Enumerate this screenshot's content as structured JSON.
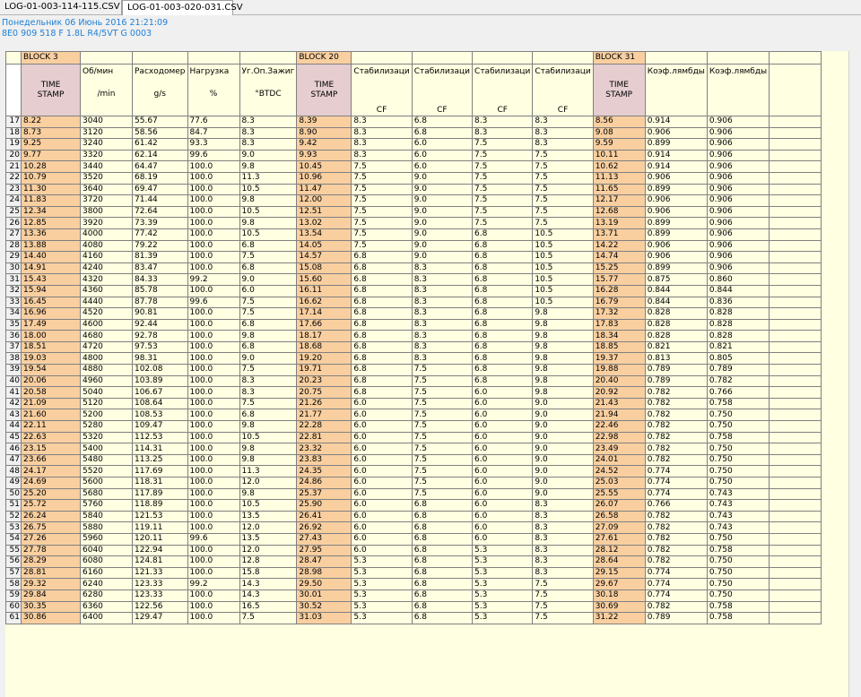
{
  "tabs": [
    "LOG-01-003-114-115.CSV",
    "LOG-01-003-020-031.CSV"
  ],
  "info": {
    "line1": "Понедельник 06 Июнь 2016 21:21:09",
    "line2": "8E0 909 518 F  1.8L R4/5VT     G   0003"
  },
  "blocks": {
    "b3": "BLOCK 3",
    "b20": "BLOCK 20",
    "b31": "BLOCK 31"
  },
  "headers": [
    {
      "top": "",
      "unit": ""
    },
    {
      "top": "TIME\nSTAMP",
      "unit": "",
      "stamp": true
    },
    {
      "top": "Об/мин",
      "unit": "/min"
    },
    {
      "top": "Расходомер",
      "unit": "g/s"
    },
    {
      "top": "Нагрузка",
      "unit": "%"
    },
    {
      "top": "Уг.Оп.Зажиг",
      "unit": "°BTDC"
    },
    {
      "top": "TIME\nSTAMP",
      "unit": "",
      "stamp": true
    },
    {
      "top": "Стабилизаци",
      "unit": "CF",
      "cf": true
    },
    {
      "top": "Стабилизаци",
      "unit": "CF",
      "cf": true
    },
    {
      "top": "Стабилизаци",
      "unit": "CF",
      "cf": true
    },
    {
      "top": "Стабилизаци",
      "unit": "CF",
      "cf": true
    },
    {
      "top": "TIME\nSTAMP",
      "unit": "",
      "stamp": true
    },
    {
      "top": "Коэф.лямбды",
      "unit": ""
    },
    {
      "top": "Коэф.лямбды",
      "unit": ""
    },
    {
      "top": "",
      "unit": ""
    }
  ],
  "rows": [
    [
      "17",
      "8.22",
      "3040",
      "55.67",
      "77.6",
      "8.3",
      "8.39",
      "8.3",
      "6.8",
      "8.3",
      "8.3",
      "8.56",
      "0.914",
      "0.906"
    ],
    [
      "18",
      "8.73",
      "3120",
      "58.56",
      "84.7",
      "8.3",
      "8.90",
      "8.3",
      "6.8",
      "8.3",
      "8.3",
      "9.08",
      "0.906",
      "0.906"
    ],
    [
      "19",
      "9.25",
      "3240",
      "61.42",
      "93.3",
      "8.3",
      "9.42",
      "8.3",
      "6.0",
      "7.5",
      "8.3",
      "9.59",
      "0.899",
      "0.906"
    ],
    [
      "20",
      "9.77",
      "3320",
      "62.14",
      "99.6",
      "9.0",
      "9.93",
      "8.3",
      "6.0",
      "7.5",
      "7.5",
      "10.11",
      "0.914",
      "0.906"
    ],
    [
      "21",
      "10.28",
      "3440",
      "64.47",
      "100.0",
      "9.8",
      "10.45",
      "7.5",
      "6.0",
      "7.5",
      "7.5",
      "10.62",
      "0.914",
      "0.906"
    ],
    [
      "22",
      "10.79",
      "3520",
      "68.19",
      "100.0",
      "11.3",
      "10.96",
      "7.5",
      "9.0",
      "7.5",
      "7.5",
      "11.13",
      "0.906",
      "0.906"
    ],
    [
      "23",
      "11.30",
      "3640",
      "69.47",
      "100.0",
      "10.5",
      "11.47",
      "7.5",
      "9.0",
      "7.5",
      "7.5",
      "11.65",
      "0.899",
      "0.906"
    ],
    [
      "24",
      "11.83",
      "3720",
      "71.44",
      "100.0",
      "9.8",
      "12.00",
      "7.5",
      "9.0",
      "7.5",
      "7.5",
      "12.17",
      "0.906",
      "0.906"
    ],
    [
      "25",
      "12.34",
      "3800",
      "72.64",
      "100.0",
      "10.5",
      "12.51",
      "7.5",
      "9.0",
      "7.5",
      "7.5",
      "12.68",
      "0.906",
      "0.906"
    ],
    [
      "26",
      "12.85",
      "3920",
      "73.39",
      "100.0",
      "9.8",
      "13.02",
      "7.5",
      "9.0",
      "7.5",
      "7.5",
      "13.19",
      "0.899",
      "0.906"
    ],
    [
      "27",
      "13.36",
      "4000",
      "77.42",
      "100.0",
      "10.5",
      "13.54",
      "7.5",
      "9.0",
      "6.8",
      "10.5",
      "13.71",
      "0.899",
      "0.906"
    ],
    [
      "28",
      "13.88",
      "4080",
      "79.22",
      "100.0",
      "6.8",
      "14.05",
      "7.5",
      "9.0",
      "6.8",
      "10.5",
      "14.22",
      "0.906",
      "0.906"
    ],
    [
      "29",
      "14.40",
      "4160",
      "81.39",
      "100.0",
      "7.5",
      "14.57",
      "6.8",
      "9.0",
      "6.8",
      "10.5",
      "14.74",
      "0.906",
      "0.906"
    ],
    [
      "30",
      "14.91",
      "4240",
      "83.47",
      "100.0",
      "6.8",
      "15.08",
      "6.8",
      "8.3",
      "6.8",
      "10.5",
      "15.25",
      "0.899",
      "0.906"
    ],
    [
      "31",
      "15.43",
      "4320",
      "84.33",
      "99.2",
      "9.0",
      "15.60",
      "6.8",
      "8.3",
      "6.8",
      "10.5",
      "15.77",
      "0.875",
      "0.860"
    ],
    [
      "32",
      "15.94",
      "4360",
      "85.78",
      "100.0",
      "6.0",
      "16.11",
      "6.8",
      "8.3",
      "6.8",
      "10.5",
      "16.28",
      "0.844",
      "0.844"
    ],
    [
      "33",
      "16.45",
      "4440",
      "87.78",
      "99.6",
      "7.5",
      "16.62",
      "6.8",
      "8.3",
      "6.8",
      "10.5",
      "16.79",
      "0.844",
      "0.836"
    ],
    [
      "34",
      "16.96",
      "4520",
      "90.81",
      "100.0",
      "7.5",
      "17.14",
      "6.8",
      "8.3",
      "6.8",
      "9.8",
      "17.32",
      "0.828",
      "0.828"
    ],
    [
      "35",
      "17.49",
      "4600",
      "92.44",
      "100.0",
      "6.8",
      "17.66",
      "6.8",
      "8.3",
      "6.8",
      "9.8",
      "17.83",
      "0.828",
      "0.828"
    ],
    [
      "36",
      "18.00",
      "4680",
      "92.78",
      "100.0",
      "9.8",
      "18.17",
      "6.8",
      "8.3",
      "6.8",
      "9.8",
      "18.34",
      "0.828",
      "0.828"
    ],
    [
      "37",
      "18.51",
      "4720",
      "97.53",
      "100.0",
      "6.8",
      "18.68",
      "6.8",
      "8.3",
      "6.8",
      "9.8",
      "18.85",
      "0.821",
      "0.821"
    ],
    [
      "38",
      "19.03",
      "4800",
      "98.31",
      "100.0",
      "9.0",
      "19.20",
      "6.8",
      "8.3",
      "6.8",
      "9.8",
      "19.37",
      "0.813",
      "0.805"
    ],
    [
      "39",
      "19.54",
      "4880",
      "102.08",
      "100.0",
      "7.5",
      "19.71",
      "6.8",
      "7.5",
      "6.8",
      "9.8",
      "19.88",
      "0.789",
      "0.789"
    ],
    [
      "40",
      "20.06",
      "4960",
      "103.89",
      "100.0",
      "8.3",
      "20.23",
      "6.8",
      "7.5",
      "6.8",
      "9.8",
      "20.40",
      "0.789",
      "0.782"
    ],
    [
      "41",
      "20.58",
      "5040",
      "106.67",
      "100.0",
      "8.3",
      "20.75",
      "6.8",
      "7.5",
      "6.0",
      "9.8",
      "20.92",
      "0.782",
      "0.766"
    ],
    [
      "42",
      "21.09",
      "5120",
      "108.64",
      "100.0",
      "7.5",
      "21.26",
      "6.0",
      "7.5",
      "6.0",
      "9.0",
      "21.43",
      "0.782",
      "0.758"
    ],
    [
      "43",
      "21.60",
      "5200",
      "108.53",
      "100.0",
      "6.8",
      "21.77",
      "6.0",
      "7.5",
      "6.0",
      "9.0",
      "21.94",
      "0.782",
      "0.750"
    ],
    [
      "44",
      "22.11",
      "5280",
      "109.47",
      "100.0",
      "9.8",
      "22.28",
      "6.0",
      "7.5",
      "6.0",
      "9.0",
      "22.46",
      "0.782",
      "0.750"
    ],
    [
      "45",
      "22.63",
      "5320",
      "112.53",
      "100.0",
      "10.5",
      "22.81",
      "6.0",
      "7.5",
      "6.0",
      "9.0",
      "22.98",
      "0.782",
      "0.758"
    ],
    [
      "46",
      "23.15",
      "5400",
      "114.31",
      "100.0",
      "9.8",
      "23.32",
      "6.0",
      "7.5",
      "6.0",
      "9.0",
      "23.49",
      "0.782",
      "0.750"
    ],
    [
      "47",
      "23.66",
      "5480",
      "113.25",
      "100.0",
      "9.8",
      "23.83",
      "6.0",
      "7.5",
      "6.0",
      "9.0",
      "24.01",
      "0.782",
      "0.750"
    ],
    [
      "48",
      "24.17",
      "5520",
      "117.69",
      "100.0",
      "11.3",
      "24.35",
      "6.0",
      "7.5",
      "6.0",
      "9.0",
      "24.52",
      "0.774",
      "0.750"
    ],
    [
      "49",
      "24.69",
      "5600",
      "118.31",
      "100.0",
      "12.0",
      "24.86",
      "6.0",
      "7.5",
      "6.0",
      "9.0",
      "25.03",
      "0.774",
      "0.750"
    ],
    [
      "50",
      "25.20",
      "5680",
      "117.89",
      "100.0",
      "9.8",
      "25.37",
      "6.0",
      "7.5",
      "6.0",
      "9.0",
      "25.55",
      "0.774",
      "0.743"
    ],
    [
      "51",
      "25.72",
      "5760",
      "118.89",
      "100.0",
      "10.5",
      "25.90",
      "6.0",
      "6.8",
      "6.0",
      "8.3",
      "26.07",
      "0.766",
      "0.743"
    ],
    [
      "52",
      "26.24",
      "5840",
      "121.53",
      "100.0",
      "13.5",
      "26.41",
      "6.0",
      "6.8",
      "6.0",
      "8.3",
      "26.58",
      "0.782",
      "0.743"
    ],
    [
      "53",
      "26.75",
      "5880",
      "119.11",
      "100.0",
      "12.0",
      "26.92",
      "6.0",
      "6.8",
      "6.0",
      "8.3",
      "27.09",
      "0.782",
      "0.743"
    ],
    [
      "54",
      "27.26",
      "5960",
      "120.11",
      "99.6",
      "13.5",
      "27.43",
      "6.0",
      "6.8",
      "6.0",
      "8.3",
      "27.61",
      "0.782",
      "0.750"
    ],
    [
      "55",
      "27.78",
      "6040",
      "122.94",
      "100.0",
      "12.0",
      "27.95",
      "6.0",
      "6.8",
      "5.3",
      "8.3",
      "28.12",
      "0.782",
      "0.758"
    ],
    [
      "56",
      "28.29",
      "6080",
      "124.81",
      "100.0",
      "12.8",
      "28.47",
      "5.3",
      "6.8",
      "5.3",
      "8.3",
      "28.64",
      "0.782",
      "0.750"
    ],
    [
      "57",
      "28.81",
      "6160",
      "121.33",
      "100.0",
      "15.8",
      "28.98",
      "5.3",
      "6.8",
      "5.3",
      "8.3",
      "29.15",
      "0.774",
      "0.750"
    ],
    [
      "58",
      "29.32",
      "6240",
      "123.33",
      "99.2",
      "14.3",
      "29.50",
      "5.3",
      "6.8",
      "5.3",
      "7.5",
      "29.67",
      "0.774",
      "0.750"
    ],
    [
      "59",
      "29.84",
      "6280",
      "123.33",
      "100.0",
      "14.3",
      "30.01",
      "5.3",
      "6.8",
      "5.3",
      "7.5",
      "30.18",
      "0.774",
      "0.750"
    ],
    [
      "60",
      "30.35",
      "6360",
      "122.56",
      "100.0",
      "16.5",
      "30.52",
      "5.3",
      "6.8",
      "5.3",
      "7.5",
      "30.69",
      "0.782",
      "0.758"
    ],
    [
      "61",
      "30.86",
      "6400",
      "129.47",
      "100.0",
      "7.5",
      "31.03",
      "5.3",
      "6.8",
      "5.3",
      "7.5",
      "31.22",
      "0.789",
      "0.758"
    ]
  ]
}
